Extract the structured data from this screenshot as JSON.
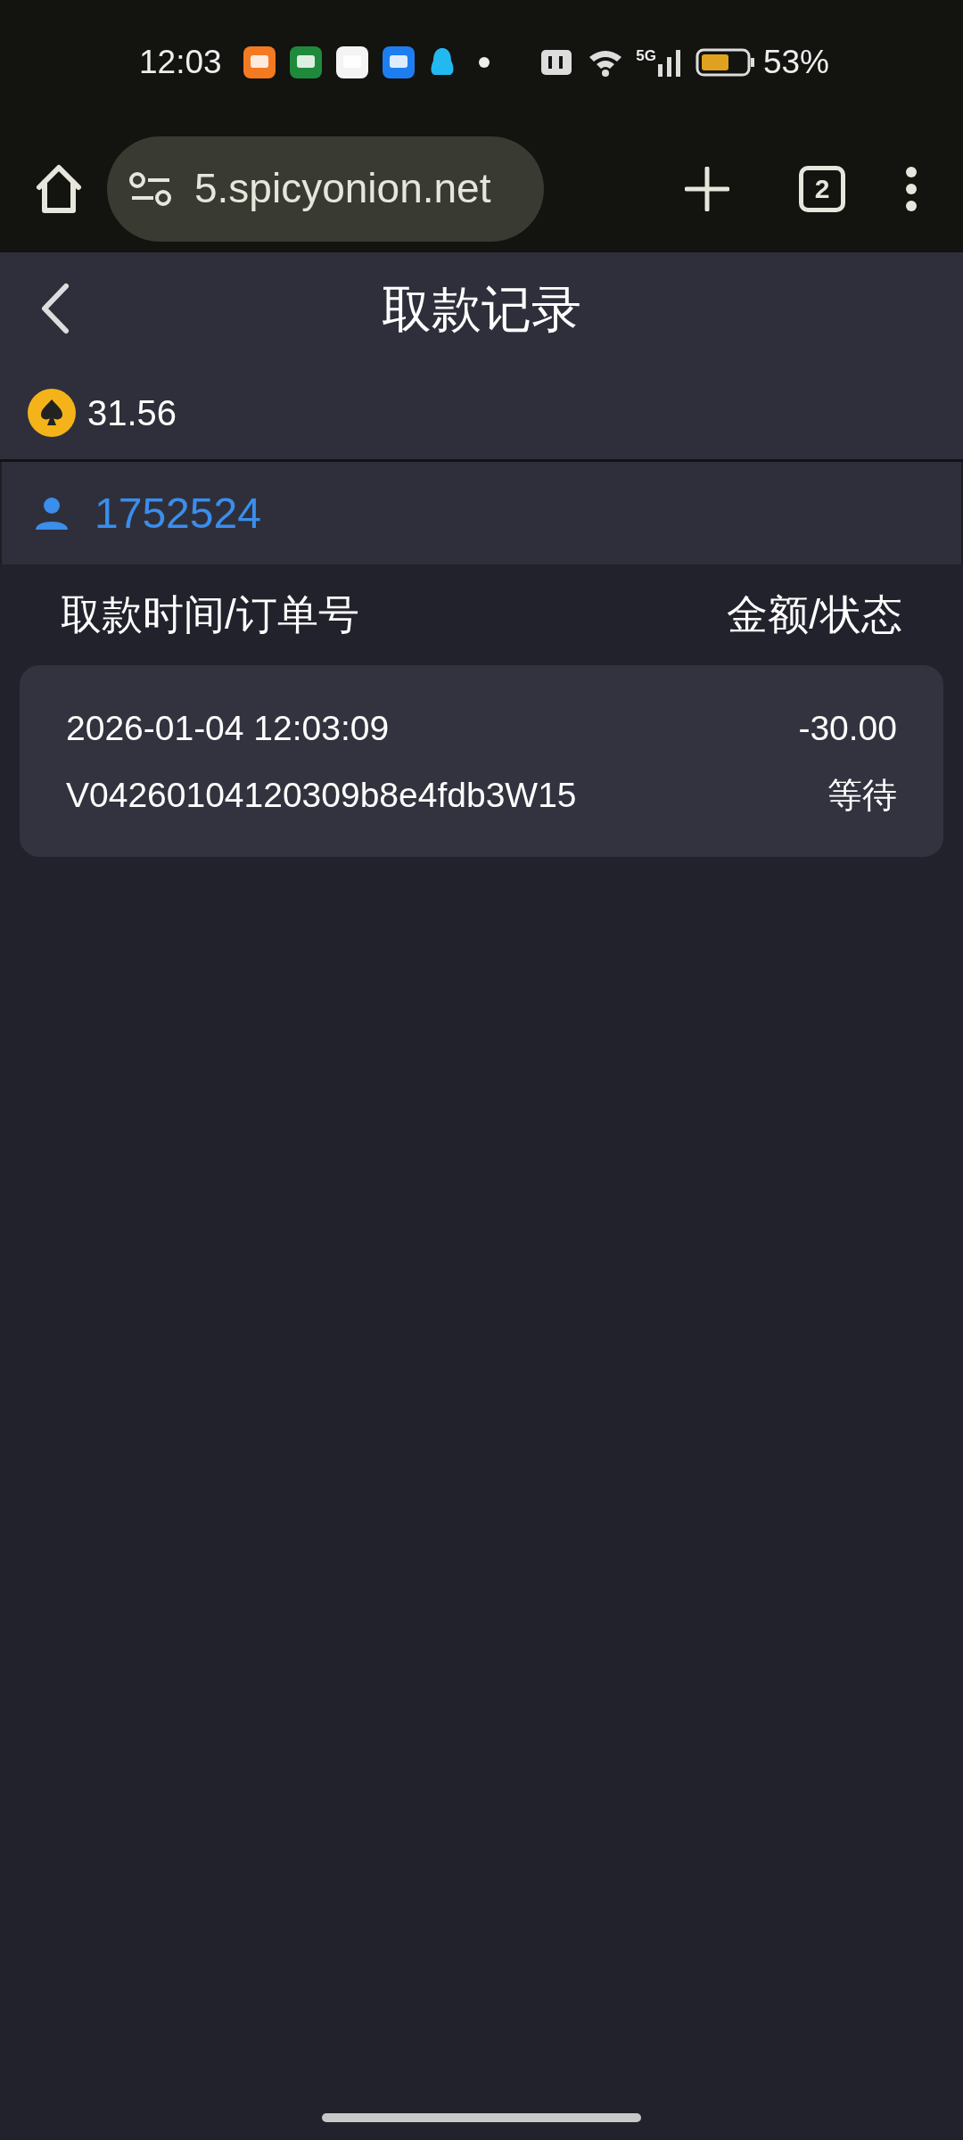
{
  "status_bar": {
    "time": "12:03",
    "network": "5G",
    "battery": "53%"
  },
  "browser": {
    "url": "5.spicyonion.net",
    "tab_count": "2"
  },
  "header": {
    "title": "取款记录"
  },
  "balance": {
    "amount": "31.56"
  },
  "user": {
    "id": "1752524"
  },
  "table": {
    "columns": [
      "取款时间/订单号",
      "金额/状态"
    ],
    "rows": [
      {
        "time": "2026-01-04 12:03:09",
        "order": "V04260104120309b8e4fdb3W15",
        "amount": "-30.00",
        "status": "等待"
      }
    ]
  }
}
